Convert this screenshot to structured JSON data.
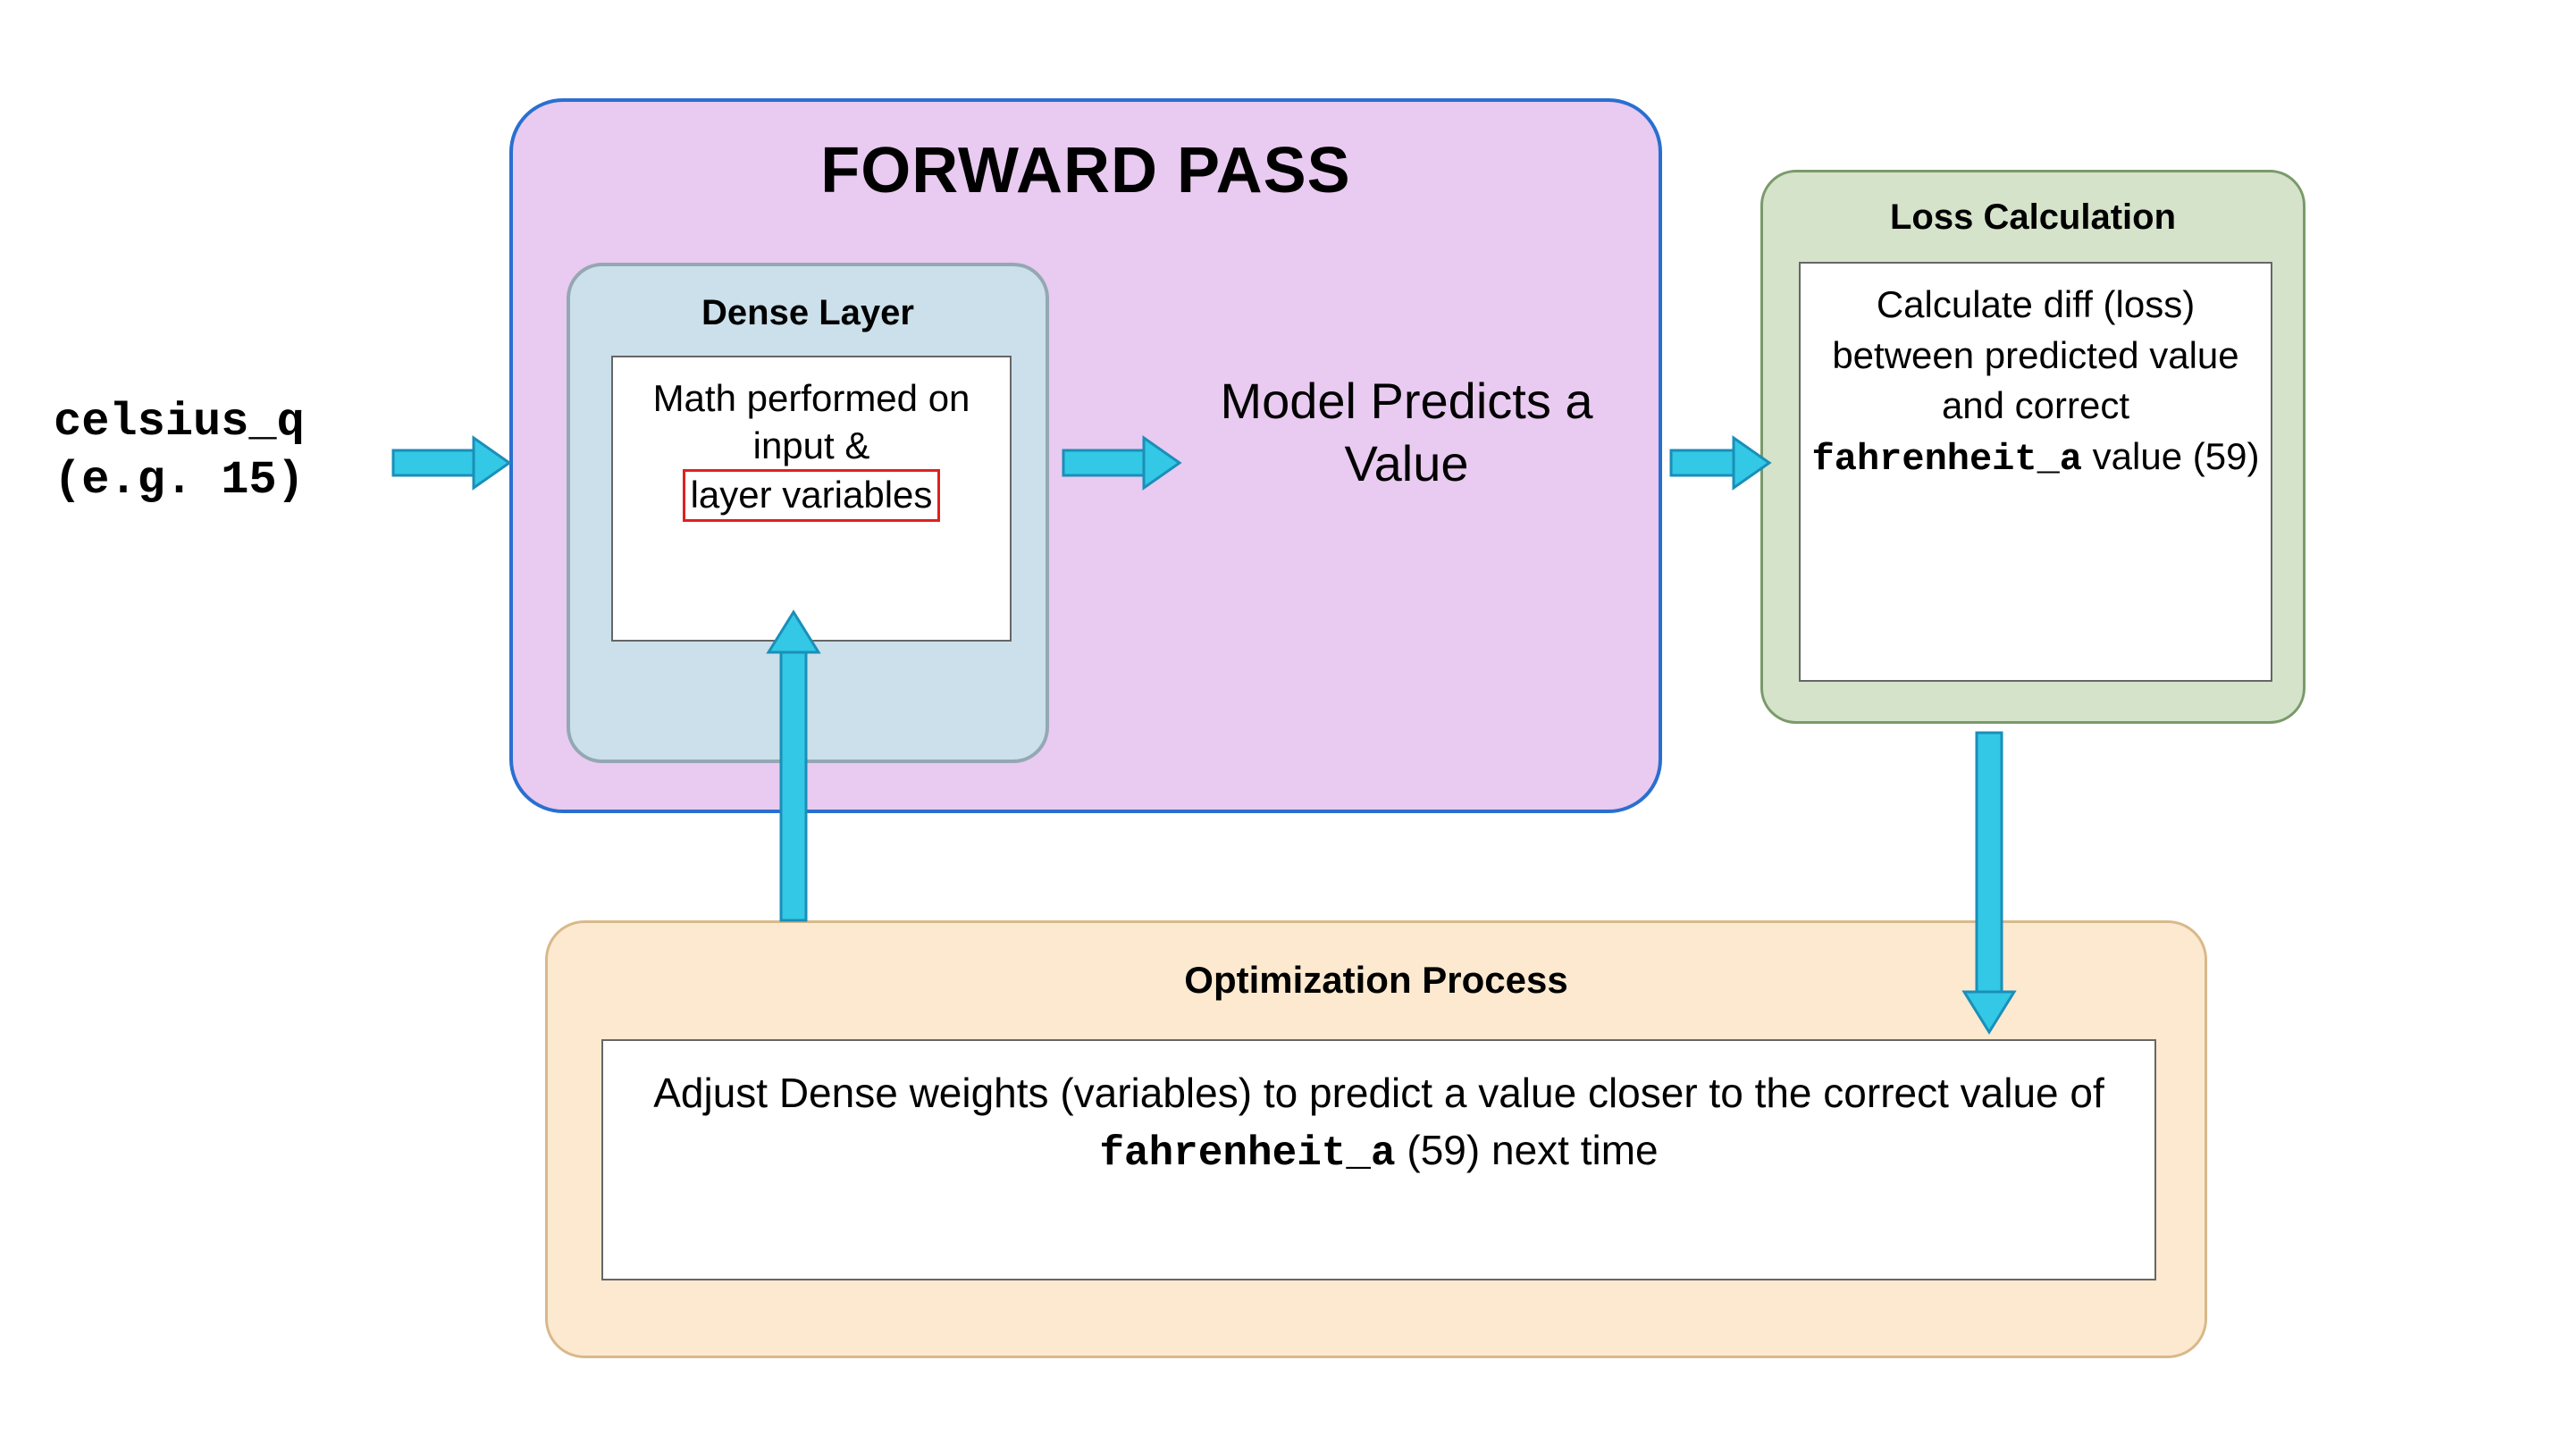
{
  "input": {
    "line1": "celsius_q",
    "line2": "(e.g. 15)"
  },
  "forward": {
    "title": "FORWARD PASS",
    "dense": {
      "title": "Dense Layer",
      "body_pre": "Math performed on input & ",
      "body_highlight": "layer variables"
    },
    "predict": "Model Predicts a Value"
  },
  "loss": {
    "title": "Loss Calculation",
    "body_pre": "Calculate diff (loss) between predicted value and correct ",
    "body_mono": "fahrenheit_a",
    "body_post": " value (59)"
  },
  "opt": {
    "title": "Optimization Process",
    "body_pre": "Adjust Dense weights (variables) to predict a value closer to the correct value of ",
    "body_mono": "fahrenheit_a",
    "body_post": " (59) next time"
  },
  "colors": {
    "arrow_fill": "#33c8e5",
    "arrow_stroke": "#1a8fb8"
  }
}
